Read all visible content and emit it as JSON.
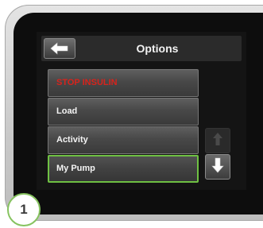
{
  "header": {
    "title": "Options",
    "back_icon": "left-arrow-icon"
  },
  "menu": {
    "items": [
      {
        "label": "STOP INSULIN",
        "state": "danger",
        "color": "#d8231c"
      },
      {
        "label": "Load",
        "state": "normal"
      },
      {
        "label": "Activity",
        "state": "normal"
      },
      {
        "label": "My Pump",
        "state": "selected",
        "highlight_color": "#6fc143"
      }
    ]
  },
  "scroll": {
    "up_icon": "up-arrow-icon",
    "up_enabled": false,
    "down_icon": "down-arrow-icon",
    "down_enabled": true
  },
  "callout": {
    "step": "1",
    "color": "#86c35f"
  }
}
